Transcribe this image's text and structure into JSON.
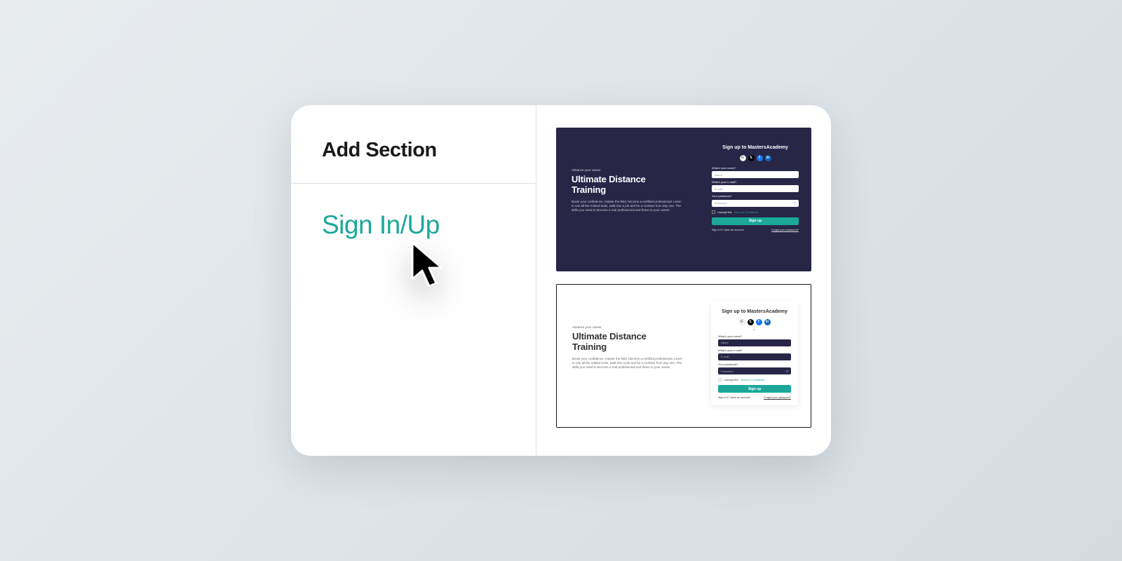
{
  "panel": {
    "title": "Add Section",
    "menu_item": "Sign In/Up"
  },
  "preview": {
    "eyebrow": "Advance your career",
    "title_line1": "Ultimate Distance",
    "title_line2": "Training",
    "description": "Boost your confidence, master the field, become a certified professional. Learn to use all the related tools, walk into a job and be a rockstar from day one. The skills you need to become a real professional and thrive in your career.",
    "form": {
      "title": "Sign up to MastersAcademy",
      "or": "or",
      "name_label": "What's your name?",
      "name_placeholder": "Name",
      "email_label": "What's your e-mail?",
      "email_placeholder": "E-mail",
      "password_label": "Your password?",
      "password_placeholder": "Password",
      "terms_prefix": "I accept the ",
      "terms_link": "Terms & Conditions",
      "signup_button": "Sign up",
      "signin_link": "Sign in if I have an account",
      "forgot_link": "Forgot your password?"
    },
    "socials": {
      "g": "G",
      "x": "𝕏",
      "f": "f",
      "l": "in"
    }
  }
}
